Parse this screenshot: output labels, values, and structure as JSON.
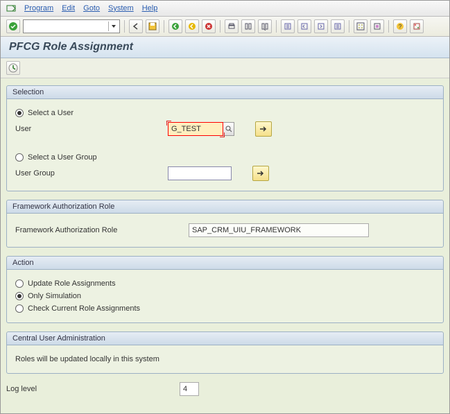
{
  "menubar": {
    "items": [
      "Program",
      "Edit",
      "Goto",
      "System",
      "Help"
    ]
  },
  "title": "PFCG Role Assignment",
  "selection": {
    "title": "Selection",
    "option_user": "Select a User",
    "label_user": "User",
    "user_value": "G_TEST",
    "option_group": "Select a User Group",
    "label_group": "User Group",
    "group_value": ""
  },
  "framework": {
    "title": "Framework Authorization Role",
    "label": "Framework Authorization Role",
    "value": "SAP_CRM_UIU_FRAMEWORK"
  },
  "action": {
    "title": "Action",
    "opt_update": "Update Role Assignments",
    "opt_sim": "Only Simulation",
    "opt_check": "Check Current Role Assignments"
  },
  "cua": {
    "title": "Central User Administration",
    "text": "Roles will be updated locally in this system"
  },
  "loglevel": {
    "label": "Log level",
    "value": "4"
  }
}
